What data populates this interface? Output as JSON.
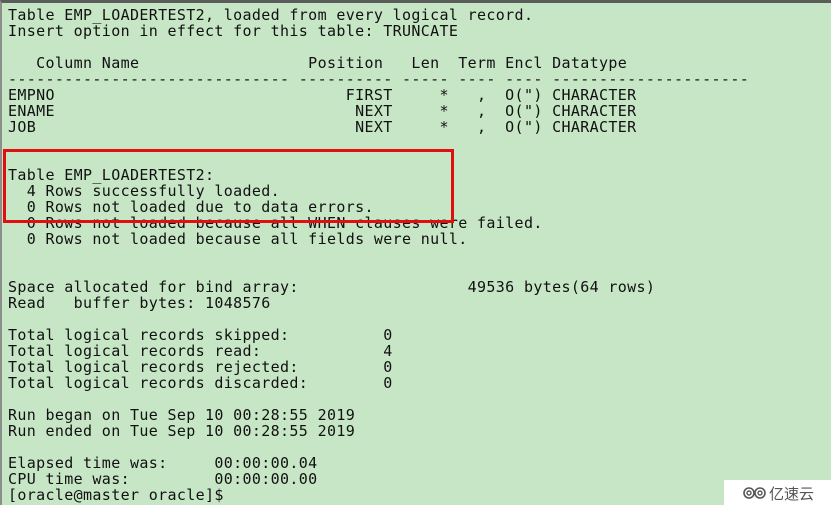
{
  "terminal": {
    "header_line": "Table EMP_LOADERTEST2, loaded from every logical record.",
    "insert_option_line": "Insert option in effect for this table: TRUNCATE",
    "columns_header": "   Column Name                  Position   Len  Term Encl Datatype",
    "columns_separator": "------------------------------ ---------- ----- ---- ---- ---------------------",
    "column_rows": [
      "EMPNO                               FIRST     *   ,  O(\") CHARACTER",
      "ENAME                                NEXT     *   ,  O(\") CHARACTER",
      "JOB                                  NEXT     *   ,  O(\") CHARACTER"
    ],
    "table_summary_title": "Table EMP_LOADERTEST2:",
    "table_summary_lines": [
      "  4 Rows successfully loaded.",
      "  0 Rows not loaded due to data errors.",
      "  0 Rows not loaded because all WHEN clauses were failed.",
      "  0 Rows not loaded because all fields were null."
    ],
    "bind_array_line": "Space allocated for bind array:                  49536 bytes(64 rows)",
    "read_buffer_line": "Read   buffer bytes: 1048576",
    "record_totals": [
      "Total logical records skipped:          0",
      "Total logical records read:             4",
      "Total logical records rejected:         0",
      "Total logical records discarded:        0"
    ],
    "run_began": "Run began on Tue Sep 10 00:28:55 2019",
    "run_ended": "Run ended on Tue Sep 10 00:28:55 2019",
    "elapsed_time": "Elapsed time was:     00:00:00.04",
    "cpu_time": "CPU time was:         00:00:00.00",
    "prompt": "[oracle@master oracle]$"
  },
  "highlight": {
    "color": "#e01010"
  },
  "watermark": {
    "logo_icon": "cloud-logo-icon",
    "text": "亿速云"
  }
}
